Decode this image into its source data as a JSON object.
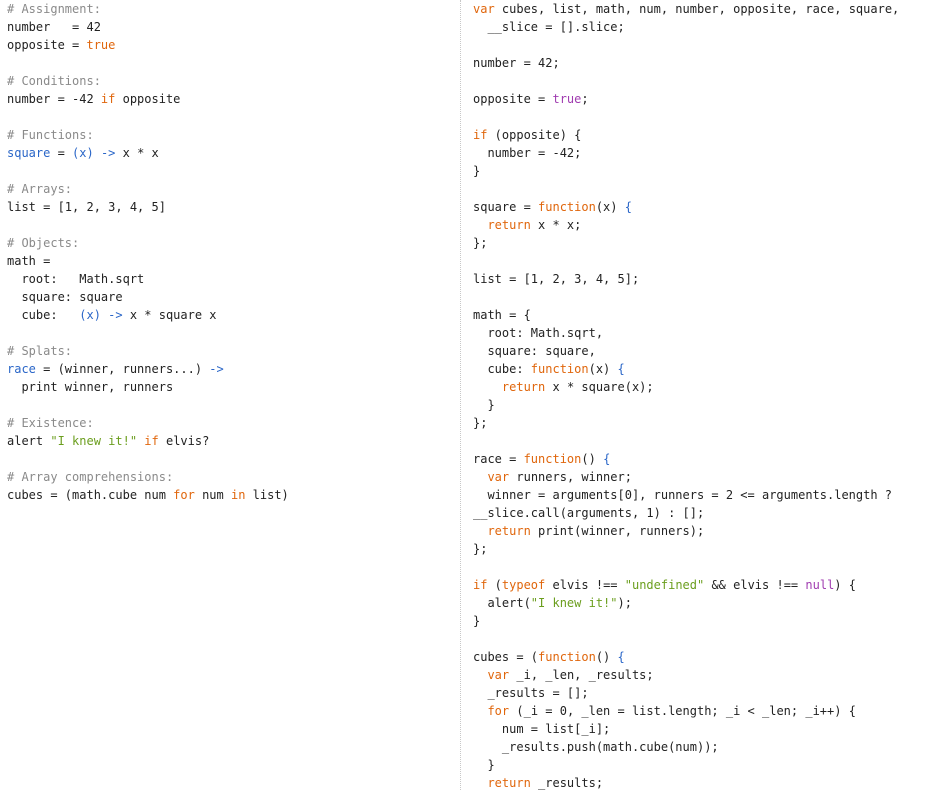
{
  "colors": {
    "background": "#ffffff",
    "plain": "#222222",
    "comment": "#8a8a8a",
    "keyword": "#e0660c",
    "boolean": "#a03cb0",
    "function_name": "#2a66c8",
    "string": "#6b9e1e"
  },
  "left_pane": {
    "language": "CoffeeScript",
    "lines": [
      [
        {
          "t": "# Assignment:",
          "c": "comment"
        }
      ],
      [
        {
          "t": "number   = 42",
          "c": "plain"
        }
      ],
      [
        {
          "t": "opposite = ",
          "c": "plain"
        },
        {
          "t": "true",
          "c": "keyword"
        }
      ],
      [],
      [
        {
          "t": "# Conditions:",
          "c": "comment"
        }
      ],
      [
        {
          "t": "number = -42 ",
          "c": "plain"
        },
        {
          "t": "if",
          "c": "keyword"
        },
        {
          "t": " opposite",
          "c": "plain"
        }
      ],
      [],
      [
        {
          "t": "# Functions:",
          "c": "comment"
        }
      ],
      [
        {
          "t": "square",
          "c": "func"
        },
        {
          "t": " = ",
          "c": "plain"
        },
        {
          "t": "(x) -> ",
          "c": "func"
        },
        {
          "t": "x * x",
          "c": "plain"
        }
      ],
      [],
      [
        {
          "t": "# Arrays:",
          "c": "comment"
        }
      ],
      [
        {
          "t": "list = [1, 2, 3, 4, 5]",
          "c": "plain"
        }
      ],
      [],
      [
        {
          "t": "# Objects:",
          "c": "comment"
        }
      ],
      [
        {
          "t": "math =",
          "c": "plain"
        }
      ],
      [
        {
          "t": "  root:   Math.sqrt",
          "c": "plain"
        }
      ],
      [
        {
          "t": "  square: square",
          "c": "plain"
        }
      ],
      [
        {
          "t": "  cube:   ",
          "c": "plain"
        },
        {
          "t": "(x) -> ",
          "c": "func"
        },
        {
          "t": "x * square x",
          "c": "plain"
        }
      ],
      [],
      [
        {
          "t": "# Splats:",
          "c": "comment"
        }
      ],
      [
        {
          "t": "race",
          "c": "func"
        },
        {
          "t": " = (winner, runners...) ",
          "c": "plain"
        },
        {
          "t": "->",
          "c": "func"
        }
      ],
      [
        {
          "t": "  print winner, runners",
          "c": "plain"
        }
      ],
      [],
      [
        {
          "t": "# Existence:",
          "c": "comment"
        }
      ],
      [
        {
          "t": "alert ",
          "c": "plain"
        },
        {
          "t": "\"I knew it!\"",
          "c": "string"
        },
        {
          "t": " ",
          "c": "plain"
        },
        {
          "t": "if",
          "c": "keyword"
        },
        {
          "t": " elvis?",
          "c": "plain"
        }
      ],
      [],
      [
        {
          "t": "# Array comprehensions:",
          "c": "comment"
        }
      ],
      [
        {
          "t": "cubes = (math.cube num ",
          "c": "plain"
        },
        {
          "t": "for",
          "c": "keyword"
        },
        {
          "t": " num ",
          "c": "plain"
        },
        {
          "t": "in",
          "c": "keyword"
        },
        {
          "t": " list)",
          "c": "plain"
        }
      ]
    ]
  },
  "right_pane": {
    "language": "JavaScript",
    "lines": [
      [
        {
          "t": "var",
          "c": "keyword"
        },
        {
          "t": " cubes, list, math, num, number, opposite, race, square,",
          "c": "plain"
        }
      ],
      [
        {
          "t": "  __slice = [].slice;",
          "c": "plain"
        }
      ],
      [],
      [
        {
          "t": "number = 42;",
          "c": "plain"
        }
      ],
      [],
      [
        {
          "t": "opposite = ",
          "c": "plain"
        },
        {
          "t": "true",
          "c": "bool"
        },
        {
          "t": ";",
          "c": "plain"
        }
      ],
      [],
      [
        {
          "t": "if",
          "c": "keyword"
        },
        {
          "t": " (opposite) {",
          "c": "plain"
        }
      ],
      [
        {
          "t": "  number = -42;",
          "c": "plain"
        }
      ],
      [
        {
          "t": "}",
          "c": "plain"
        }
      ],
      [],
      [
        {
          "t": "square = ",
          "c": "plain"
        },
        {
          "t": "function",
          "c": "keyword"
        },
        {
          "t": "(x) ",
          "c": "plain"
        },
        {
          "t": "{",
          "c": "func"
        }
      ],
      [
        {
          "t": "  ",
          "c": "plain"
        },
        {
          "t": "return",
          "c": "keyword"
        },
        {
          "t": " x * x;",
          "c": "plain"
        }
      ],
      [
        {
          "t": "};",
          "c": "plain"
        }
      ],
      [],
      [
        {
          "t": "list = [1, 2, 3, 4, 5];",
          "c": "plain"
        }
      ],
      [],
      [
        {
          "t": "math = {",
          "c": "plain"
        }
      ],
      [
        {
          "t": "  root: Math.sqrt,",
          "c": "plain"
        }
      ],
      [
        {
          "t": "  square: square,",
          "c": "plain"
        }
      ],
      [
        {
          "t": "  cube: ",
          "c": "plain"
        },
        {
          "t": "function",
          "c": "keyword"
        },
        {
          "t": "(x) ",
          "c": "plain"
        },
        {
          "t": "{",
          "c": "func"
        }
      ],
      [
        {
          "t": "    ",
          "c": "plain"
        },
        {
          "t": "return",
          "c": "keyword"
        },
        {
          "t": " x * square(x);",
          "c": "plain"
        }
      ],
      [
        {
          "t": "  }",
          "c": "plain"
        }
      ],
      [
        {
          "t": "};",
          "c": "plain"
        }
      ],
      [],
      [
        {
          "t": "race = ",
          "c": "plain"
        },
        {
          "t": "function",
          "c": "keyword"
        },
        {
          "t": "() ",
          "c": "plain"
        },
        {
          "t": "{",
          "c": "func"
        }
      ],
      [
        {
          "t": "  ",
          "c": "plain"
        },
        {
          "t": "var",
          "c": "keyword"
        },
        {
          "t": " runners, winner;",
          "c": "plain"
        }
      ],
      [
        {
          "t": "  winner = arguments[0], runners = 2 <= arguments.length ?",
          "c": "plain"
        }
      ],
      [
        {
          "t": "__slice.call(arguments, 1) : [];",
          "c": "plain"
        }
      ],
      [
        {
          "t": "  ",
          "c": "plain"
        },
        {
          "t": "return",
          "c": "keyword"
        },
        {
          "t": " print(winner, runners);",
          "c": "plain"
        }
      ],
      [
        {
          "t": "};",
          "c": "plain"
        }
      ],
      [],
      [
        {
          "t": "if",
          "c": "keyword"
        },
        {
          "t": " (",
          "c": "plain"
        },
        {
          "t": "typeof",
          "c": "keyword"
        },
        {
          "t": " elvis !== ",
          "c": "plain"
        },
        {
          "t": "\"undefined\"",
          "c": "string"
        },
        {
          "t": " && elvis !== ",
          "c": "plain"
        },
        {
          "t": "null",
          "c": "bool"
        },
        {
          "t": ") {",
          "c": "plain"
        }
      ],
      [
        {
          "t": "  alert(",
          "c": "plain"
        },
        {
          "t": "\"I knew it!\"",
          "c": "string"
        },
        {
          "t": ");",
          "c": "plain"
        }
      ],
      [
        {
          "t": "}",
          "c": "plain"
        }
      ],
      [],
      [
        {
          "t": "cubes = (",
          "c": "plain"
        },
        {
          "t": "function",
          "c": "keyword"
        },
        {
          "t": "() ",
          "c": "plain"
        },
        {
          "t": "{",
          "c": "func"
        }
      ],
      [
        {
          "t": "  ",
          "c": "plain"
        },
        {
          "t": "var",
          "c": "keyword"
        },
        {
          "t": " _i, _len, _results;",
          "c": "plain"
        }
      ],
      [
        {
          "t": "  _results = [];",
          "c": "plain"
        }
      ],
      [
        {
          "t": "  ",
          "c": "plain"
        },
        {
          "t": "for",
          "c": "keyword"
        },
        {
          "t": " (_i = 0, _len = list.length; _i < _len; _i++) {",
          "c": "plain"
        }
      ],
      [
        {
          "t": "    num = list[_i];",
          "c": "plain"
        }
      ],
      [
        {
          "t": "    _results.push(math.cube(num));",
          "c": "plain"
        }
      ],
      [
        {
          "t": "  }",
          "c": "plain"
        }
      ],
      [
        {
          "t": "  ",
          "c": "plain"
        },
        {
          "t": "return",
          "c": "keyword"
        },
        {
          "t": " _results;",
          "c": "plain"
        }
      ]
    ]
  }
}
